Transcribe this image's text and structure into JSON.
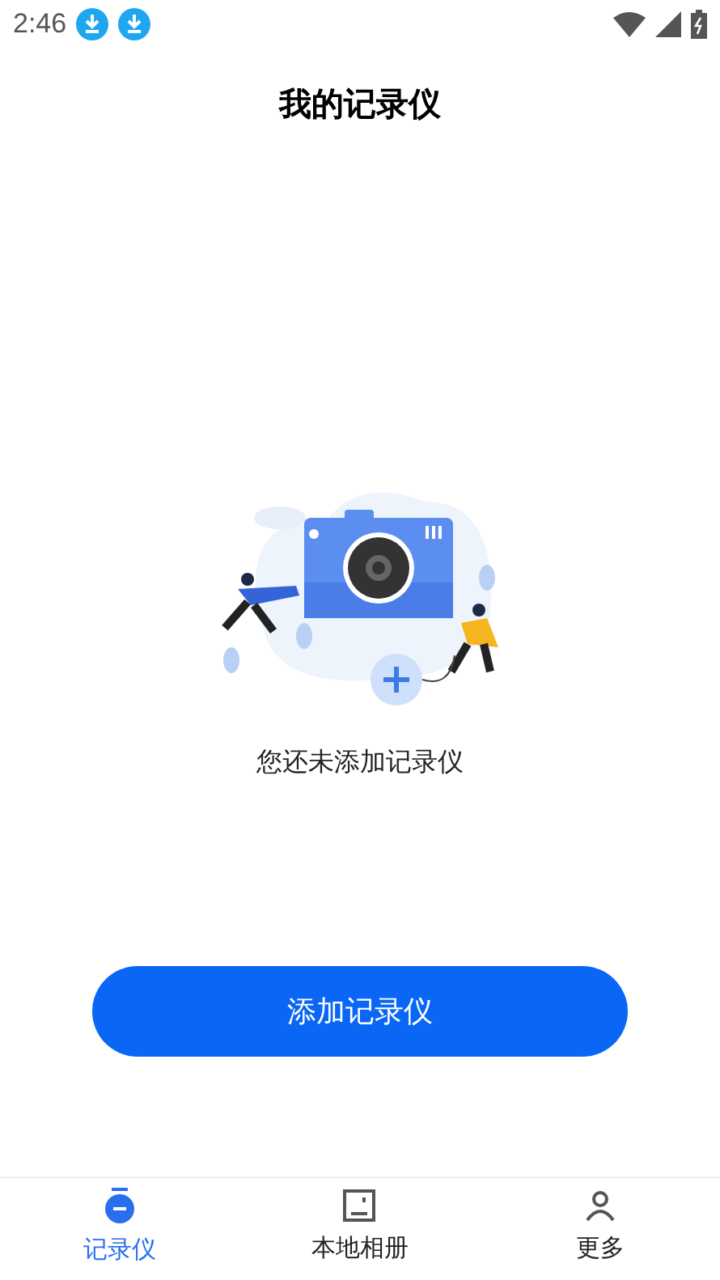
{
  "status_bar": {
    "time": "2:46"
  },
  "title": "我的记录仪",
  "empty_state": {
    "message": "您还未添加记录仪"
  },
  "add_button": "添加记录仪",
  "tabs": [
    {
      "label": "记录仪",
      "selected": true
    },
    {
      "label": "本地相册",
      "selected": false
    },
    {
      "label": "更多",
      "selected": false
    }
  ]
}
